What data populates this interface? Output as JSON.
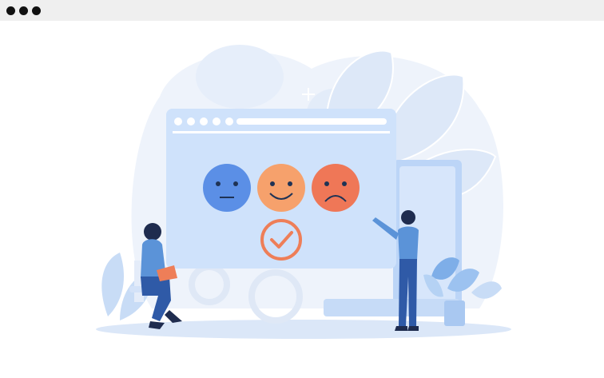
{
  "window": {
    "controls": [
      "dot",
      "dot",
      "dot"
    ]
  },
  "illustration": {
    "feedback_faces": [
      {
        "mood": "neutral",
        "color": "#5b8fe6"
      },
      {
        "mood": "happy",
        "color": "#f6a16c"
      },
      {
        "mood": "sad",
        "color": "#ef7757"
      }
    ],
    "selection_indicator": "check-circle-icon",
    "colors": {
      "panel": "#cfe2fb",
      "panel_dark": "#b9d3f6",
      "accent_orange": "#ee7e58",
      "figure_shirt": "#5b93d8",
      "figure_pants": "#2f5aa7",
      "leaf": "#c8dcf6",
      "ground": "#dbe7f8"
    }
  }
}
